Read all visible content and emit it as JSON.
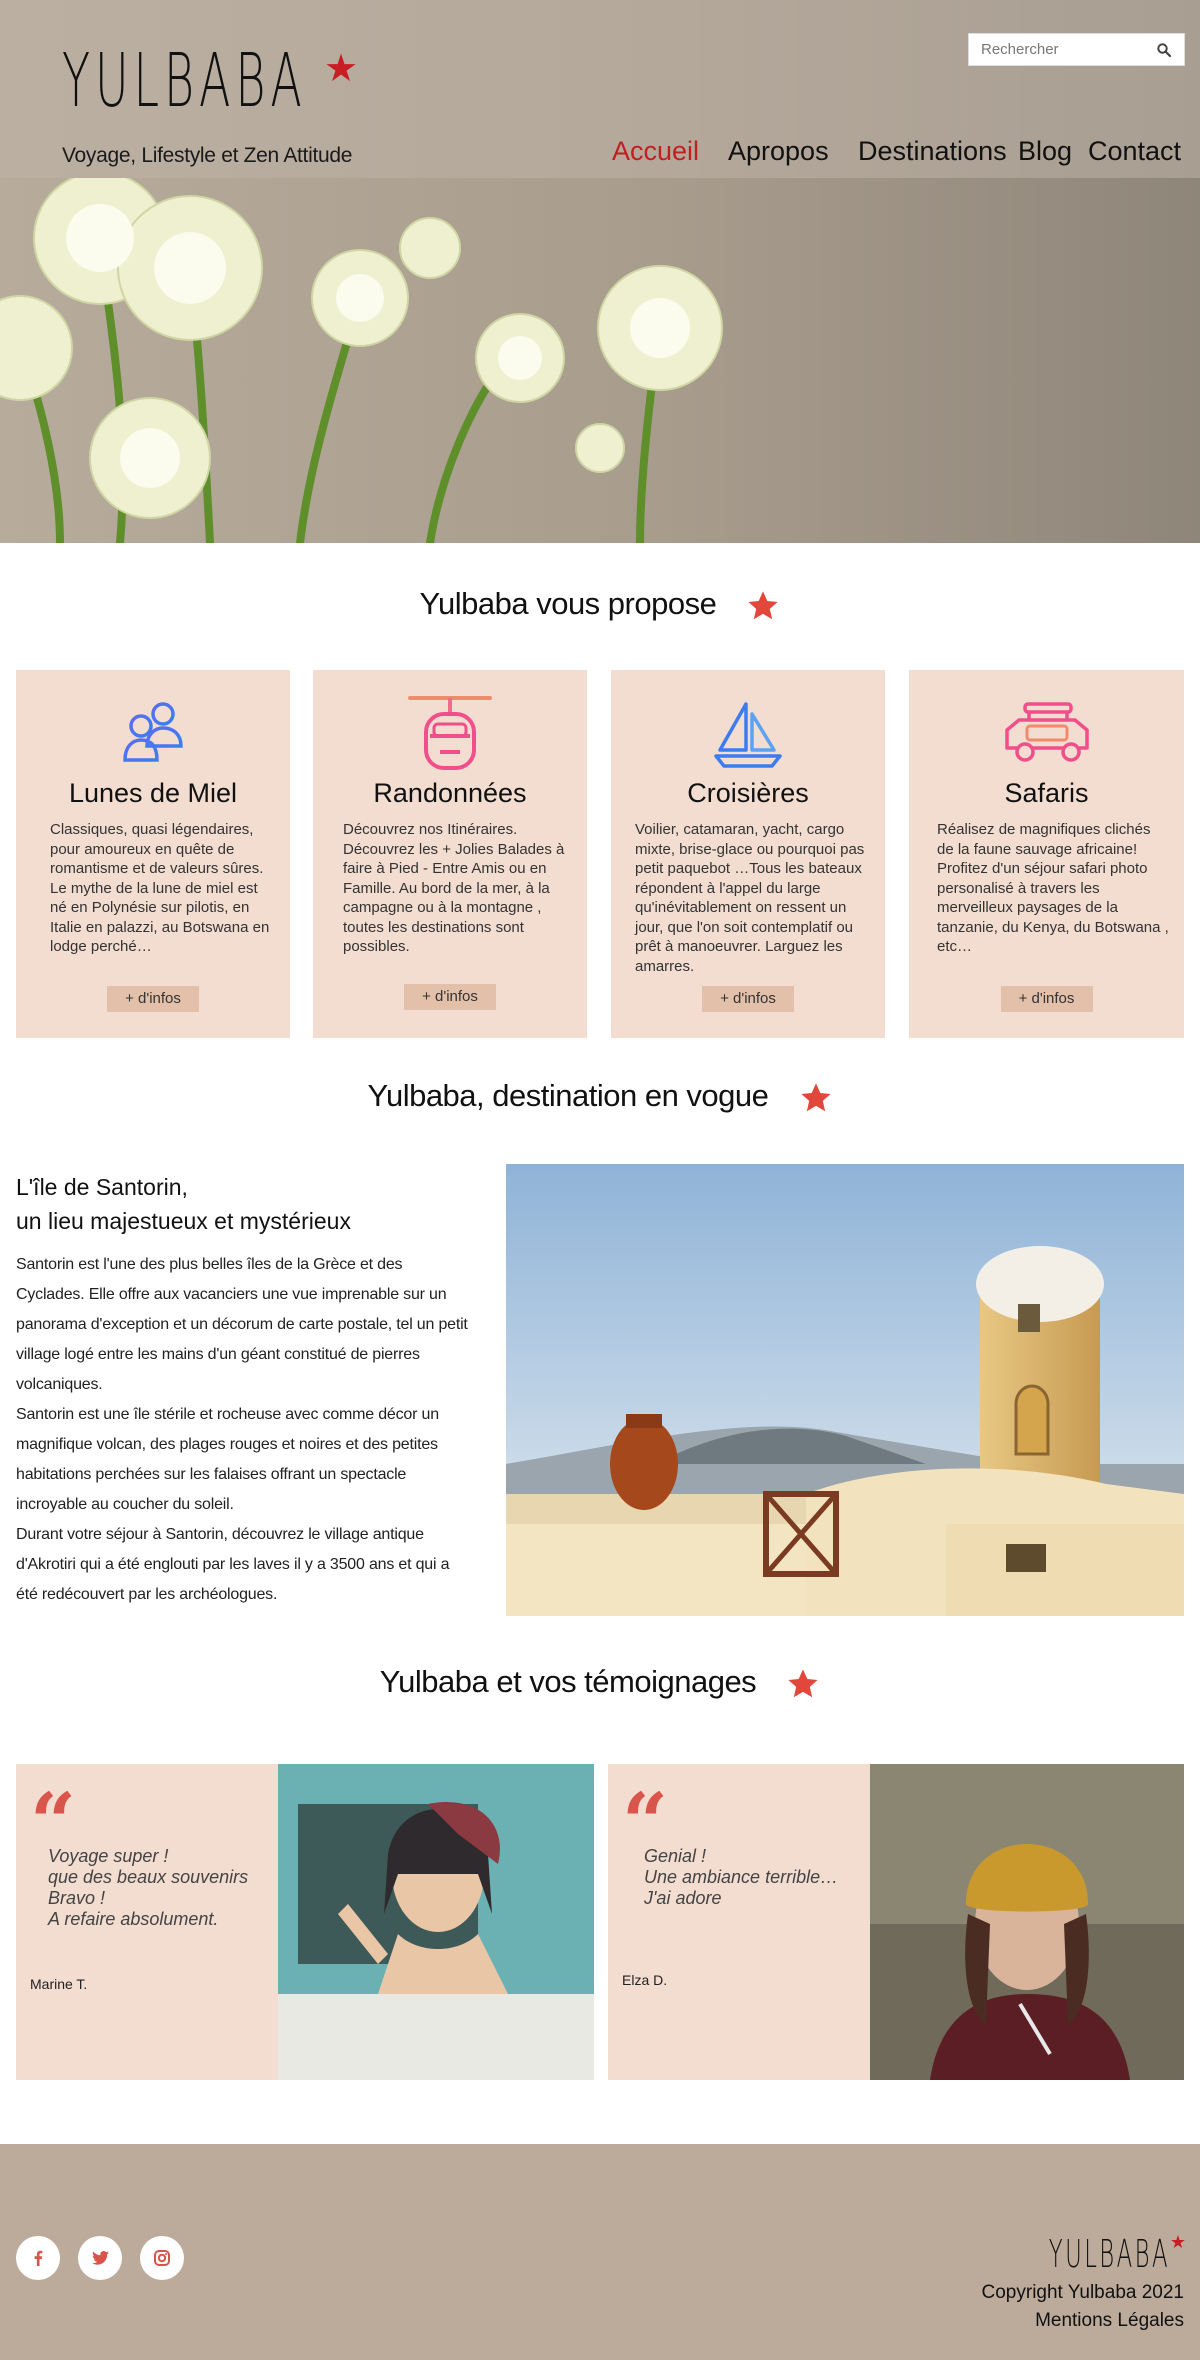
{
  "header": {
    "logo_text": "YULBABA",
    "tagline": "Voyage, Lifestyle et Zen Attitude",
    "search_placeholder": "Rechercher",
    "nav": [
      "Accueil",
      "Apropos",
      "Destinations",
      "Blog",
      "Contact"
    ]
  },
  "propose": {
    "title": "Yulbaba vous propose",
    "cards": [
      {
        "title": "Lunes de Miel",
        "icon": "couple-icon",
        "text": "Classiques, quasi légendaires, pour amoureux en quête de romantisme et de valeurs sûres. Le mythe de la lune de miel est né en Polynésie sur pilotis, en Italie en palazzi, au Botswana en lodge perché…",
        "button": "+ d'infos"
      },
      {
        "title": "Randonnées",
        "icon": "cable-car-icon",
        "text": "Découvrez nos Itinéraires. Découvrez les + Jolies Balades à faire à Pied - Entre Amis ou en Famille.\nAu bord de la mer, à la campagne ou à la montagne , toutes les destinations sont possibles.",
        "button": "+ d'infos"
      },
      {
        "title": "Croisières",
        "icon": "sailboat-icon",
        "text": "Voilier, catamaran, yacht, cargo mixte, brise-glace ou pourquoi pas petit paquebot …Tous les bateaux répondent à l'appel du large qu'inévitablement on ressent un jour, que l'on soit contemplatif ou prêt à manoeuvrer. Larguez les amarres.",
        "button": "+ d'infos"
      },
      {
        "title": "Safaris",
        "icon": "jeep-icon",
        "text": "Réalisez de magnifiques clichés de la faune sauvage africaine! Profitez d'un séjour safari photo personalisé à travers les merveilleux paysages de la tanzanie, du Kenya, du Botswana , etc…",
        "button": "+ d'infos"
      }
    ]
  },
  "vogue": {
    "title": "Yulbaba, destination en vogue",
    "heading_line1": "L'île de Santorin,",
    "heading_line2": "un lieu majestueux et mystérieux",
    "paragraph": "Santorin est l'une des plus belles îles de la Grèce et des Cyclades. Elle offre aux vacanciers une vue imprenable sur un panorama d'exception et un décorum de carte postale, tel un petit village logé entre les mains d'un géant constitué de pierres volcaniques.\nSantorin est une île stérile et rocheuse avec comme décor un magnifique volcan, des plages rouges et noires et des petites habitations perchées sur les falaises offrant un spectacle incroyable au coucher du soleil.\nDurant votre séjour à Santorin, découvrez le village antique d'Akrotiri qui a été englouti par les laves il y a 3500 ans et qui a été redécouvert par les archéologues."
  },
  "testimonials": {
    "title": "Yulbaba et vos témoignages",
    "items": [
      {
        "lines": [
          "Voyage super !",
          "que des beaux souvenirs",
          "Bravo !",
          "A refaire absolument."
        ],
        "author": "Marine T."
      },
      {
        "lines": [
          "Genial !",
          "Une ambiance terrible…",
          "J'ai adore"
        ],
        "author": "Elza D."
      }
    ]
  },
  "footer": {
    "logo_text": "YULBABA",
    "copyright": "Copyright Yulbaba 2021",
    "legal": "Mentions Légales",
    "social": [
      "facebook-icon",
      "twitter-icon",
      "instagram-icon"
    ]
  },
  "colors": {
    "accent": "#c0201f",
    "star": "#e2473b",
    "card_bg": "#f2ddd0",
    "button_bg": "#e2c0aa",
    "footer_bg": "#bcab9b"
  }
}
